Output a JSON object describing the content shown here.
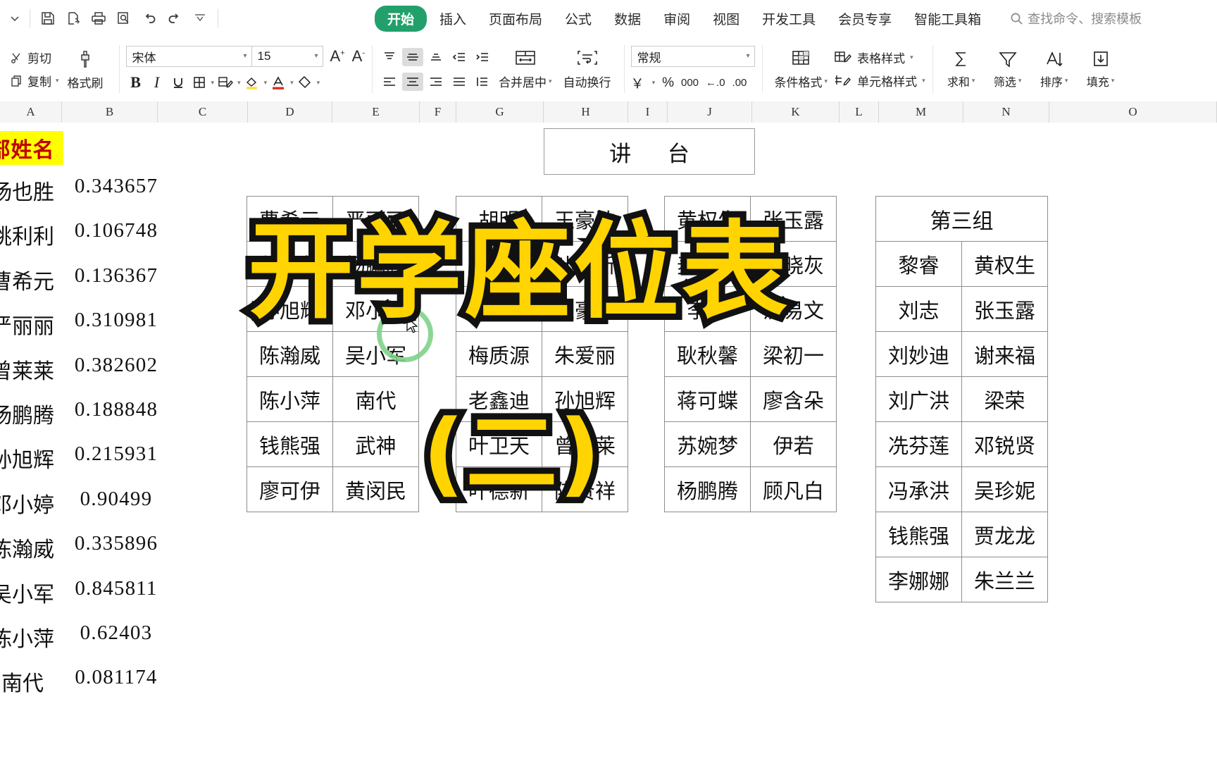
{
  "app": {
    "quick_access": [
      "save-icon",
      "undo-history-icon",
      "print-icon",
      "print-preview-icon",
      "undo-icon",
      "redo-icon",
      "customize-qat-icon"
    ]
  },
  "menu": {
    "items": [
      {
        "label": "开始",
        "active": true
      },
      {
        "label": "插入",
        "active": false
      },
      {
        "label": "页面布局",
        "active": false
      },
      {
        "label": "公式",
        "active": false
      },
      {
        "label": "数据",
        "active": false
      },
      {
        "label": "审阅",
        "active": false
      },
      {
        "label": "视图",
        "active": false
      },
      {
        "label": "开发工具",
        "active": false
      },
      {
        "label": "会员专享",
        "active": false
      },
      {
        "label": "智能工具箱",
        "active": false
      }
    ],
    "search_placeholder": "查找命令、搜索模板"
  },
  "ribbon": {
    "clipboard": {
      "cut": "剪切",
      "copy": "复制",
      "format_painter": "格式刷"
    },
    "font": {
      "name": "宋体",
      "size": "15",
      "grow": "A",
      "shrink": "A",
      "bold": "B",
      "italic": "I",
      "underline": "U"
    },
    "align": {
      "merge": "合并居中",
      "wrap": "自动换行"
    },
    "number": {
      "format": "常规",
      "currency": "￥",
      "percent": "%",
      "comma": "000",
      "dec_less": "←.0",
      "dec_more": ".00"
    },
    "styles": {
      "conditional": "条件格式",
      "table_style": "表格样式",
      "cell_style": "单元格样式"
    },
    "editing": {
      "sum": "求和",
      "filter": "筛选",
      "sort": "排序",
      "fill": "填充"
    }
  },
  "sheet": {
    "column_headers": [
      "A",
      "B",
      "C",
      "D",
      "E",
      "F",
      "G",
      "H",
      "I",
      "J",
      "K",
      "L",
      "M",
      "N",
      "O"
    ],
    "name_header": "部姓名",
    "rows": [
      {
        "name": "杨也胜",
        "value": "0.343657"
      },
      {
        "name": "姚利利",
        "value": "0.106748"
      },
      {
        "name": "曹希元",
        "value": "0.136367"
      },
      {
        "name": "严丽丽",
        "value": "0.310981"
      },
      {
        "name": "曾莱莱",
        "value": "0.382602"
      },
      {
        "name": "杨鹏腾",
        "value": "0.188848"
      },
      {
        "name": "孙旭辉",
        "value": "0.215931"
      },
      {
        "name": "邓小婷",
        "value": "0.90499"
      },
      {
        "name": "陈瀚威",
        "value": "0.335896"
      },
      {
        "name": "吴小军",
        "value": "0.845811"
      },
      {
        "name": "陈小萍",
        "value": "0.62403"
      },
      {
        "name": "南代",
        "value": "0.081174"
      }
    ]
  },
  "seating": {
    "podium": "讲 台",
    "group1": {
      "rows": [
        [
          "曹希元",
          "严丽丽"
        ],
        [
          "曾莱莱",
          "杨鹏腾"
        ],
        [
          "孙旭辉",
          "邓小婷"
        ],
        [
          "陈瀚威",
          "吴小军"
        ],
        [
          "陈小萍",
          "南代"
        ],
        [
          "钱熊强",
          "武神"
        ],
        [
          "廖可伊",
          "黄闵民"
        ]
      ]
    },
    "group2": {
      "rows": [
        [
          "胡明",
          "王豪浩"
        ],
        [
          "余芬芳",
          "叶德新"
        ],
        [
          "楠楠",
          "王豪浩"
        ],
        [
          "梅质源",
          "朱爱丽"
        ],
        [
          "老鑫迪",
          "孙旭辉"
        ],
        [
          "叶卫天",
          "曾莱莱"
        ],
        [
          "叶德新",
          "陈贤祥"
        ]
      ]
    },
    "group3": {
      "rows": [
        [
          "黄权生",
          "张玉露"
        ],
        [
          "麦莹莹",
          "谭晓灰"
        ],
        [
          "李辉",
          "洪易文"
        ],
        [
          "耿秋馨",
          "梁初一"
        ],
        [
          "蒋可蝶",
          "廖含朵"
        ],
        [
          "苏婉梦",
          "伊若"
        ],
        [
          "杨鹏腾",
          "顾凡白"
        ]
      ]
    },
    "group4": {
      "title": "第三组",
      "rows": [
        [
          "黎睿",
          "黄权生"
        ],
        [
          "刘志",
          "张玉露"
        ],
        [
          "刘妙迪",
          "谢来福"
        ],
        [
          "刘广洪",
          "梁荣"
        ],
        [
          "冼芬莲",
          "邓锐贤"
        ],
        [
          "冯承洪",
          "吴珍妮"
        ],
        [
          "钱熊强",
          "贾龙龙"
        ],
        [
          "李娜娜",
          "朱兰兰"
        ]
      ]
    }
  },
  "overlay": {
    "line1": "开学座位表",
    "line2": "(二)"
  },
  "colors": {
    "accent_green": "#22a06b",
    "overlay_yellow": "#FFD400",
    "overlay_stroke": "#111111",
    "header_highlight": "#FFFF00",
    "header_text": "#C00000"
  }
}
